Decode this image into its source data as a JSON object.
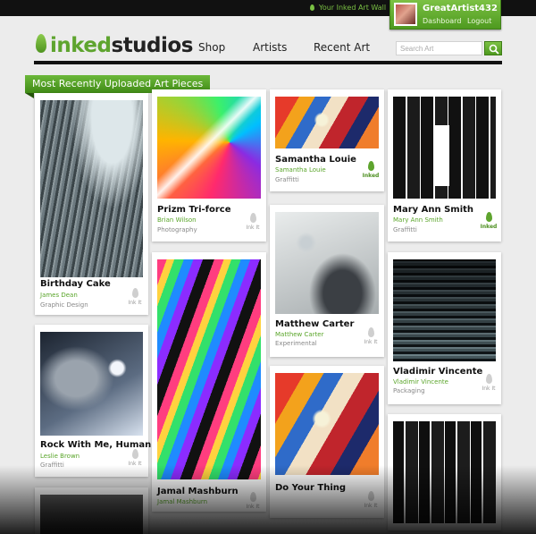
{
  "header": {
    "wall_link": "Your Inked Art Wall",
    "user": {
      "name": "GreatArtist432",
      "dashboard": "Dashboard",
      "logout": "Logout"
    },
    "brand_part1": "inked",
    "brand_part2": "studios",
    "nav": [
      "Shop",
      "Artists",
      "Recent Art"
    ],
    "search_placeholder": "Search Art"
  },
  "section_title": "Most Recently Uploaded Art Pieces",
  "ink_labels": {
    "off": "Ink It",
    "on": "Inked"
  },
  "colors": {
    "accent": "#5ea42e",
    "topbar": "#111111",
    "background": "#ececec"
  },
  "cards": [
    {
      "title": "Birthday Cake",
      "artist": "James Dean",
      "category": "Graphic Design",
      "inked": false
    },
    {
      "title": "Prizm Tri-force",
      "artist": "Brian Wilson",
      "category": "Photography",
      "inked": false
    },
    {
      "title": "Samantha Louie",
      "artist": "Samantha Louie",
      "category": "Graffitti",
      "inked": true
    },
    {
      "title": "Mary Ann Smith",
      "artist": "Mary Ann Smith",
      "category": "Graffitti",
      "inked": true
    },
    {
      "title": "Matthew Carter",
      "artist": "Matthew Carter",
      "category": "Experimental",
      "inked": false
    },
    {
      "title": "Vladimir Vincente",
      "artist": "Vladimir Vincente",
      "category": "Packaging",
      "inked": false
    },
    {
      "title": "Rock With Me, Human",
      "artist": "Leslie Brown",
      "category": "Graffitti",
      "inked": false
    },
    {
      "title": "Jamal Mashburn",
      "artist": "Jamal Mashburn",
      "category": "",
      "inked": false
    },
    {
      "title": "Do Your Thing",
      "artist": "",
      "category": "",
      "inked": false
    }
  ]
}
